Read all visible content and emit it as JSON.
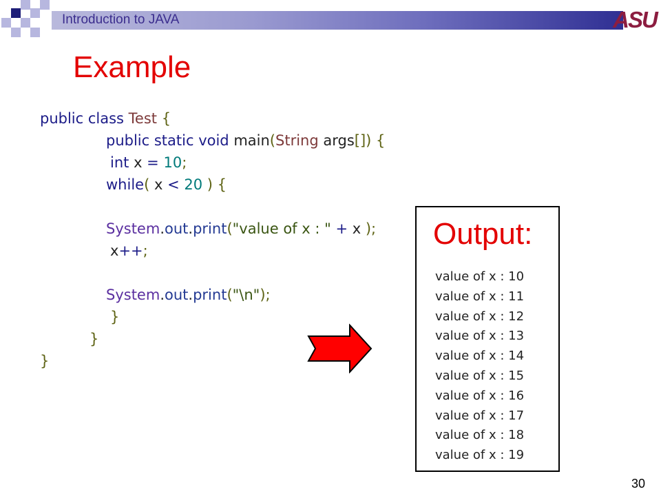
{
  "header": {
    "title": "Introduction to JAVA",
    "logo_text": "ASU",
    "bar_gradient_start": "#b9b9dc",
    "bar_gradient_end": "#2f2f93",
    "logo_color": "#8c1d40"
  },
  "slide": {
    "title": "Example",
    "title_color": "#e30000",
    "page_number": "30"
  },
  "code": {
    "lines": [
      [
        [
          "kw",
          "public class "
        ],
        [
          "ty",
          "Test "
        ],
        [
          "br",
          "{"
        ]
      ],
      [
        [
          "kw",
          "public static void "
        ],
        [
          "pl",
          "main"
        ],
        [
          "br",
          "("
        ],
        [
          "ty",
          "String "
        ],
        [
          "pl",
          "args"
        ],
        [
          "br",
          "[]) {"
        ]
      ],
      [
        [
          "kw",
          "int "
        ],
        [
          "pl",
          "x "
        ],
        [
          "op",
          "= "
        ],
        [
          "num",
          "10"
        ],
        [
          "br",
          ";"
        ]
      ],
      [
        [
          "kw",
          "while"
        ],
        [
          "br",
          "( "
        ],
        [
          "pl",
          "x "
        ],
        [
          "op",
          "< "
        ],
        [
          "num",
          "20 "
        ],
        [
          "br",
          ") {"
        ]
      ],
      [],
      [
        [
          "pk",
          "System"
        ],
        [
          "pl",
          "."
        ],
        [
          "fn",
          "out"
        ],
        [
          "pl",
          "."
        ],
        [
          "fn",
          "print"
        ],
        [
          "br",
          "("
        ],
        [
          "str",
          "\"value of x : \" "
        ],
        [
          "op",
          "+ "
        ],
        [
          "pl",
          "x "
        ],
        [
          "br",
          ");"
        ]
      ],
      [
        [
          "pl",
          "x"
        ],
        [
          "op",
          "++"
        ],
        [
          "br",
          ";"
        ]
      ],
      [],
      [
        [
          "pk",
          "System"
        ],
        [
          "pl",
          "."
        ],
        [
          "fn",
          "out"
        ],
        [
          "pl",
          "."
        ],
        [
          "fn",
          "print"
        ],
        [
          "br",
          "("
        ],
        [
          "str",
          "\"\\n\""
        ],
        [
          "br",
          ");"
        ]
      ],
      [
        [
          "br",
          "}"
        ]
      ],
      [
        [
          "br",
          "}"
        ]
      ],
      [
        [
          "br",
          "}"
        ]
      ]
    ]
  },
  "output": {
    "title": "Output:",
    "lines": [
      "value of x : 10",
      "value of x : 11",
      "value of x : 12",
      "value of x : 13",
      "value of x : 14",
      "value of x : 15",
      "value of x : 16",
      "value of x : 17",
      "value of x : 18",
      "value of x : 19"
    ]
  },
  "icons": {
    "arrow": "red-right-arrow-icon",
    "arrow_color": "#ff0000"
  }
}
